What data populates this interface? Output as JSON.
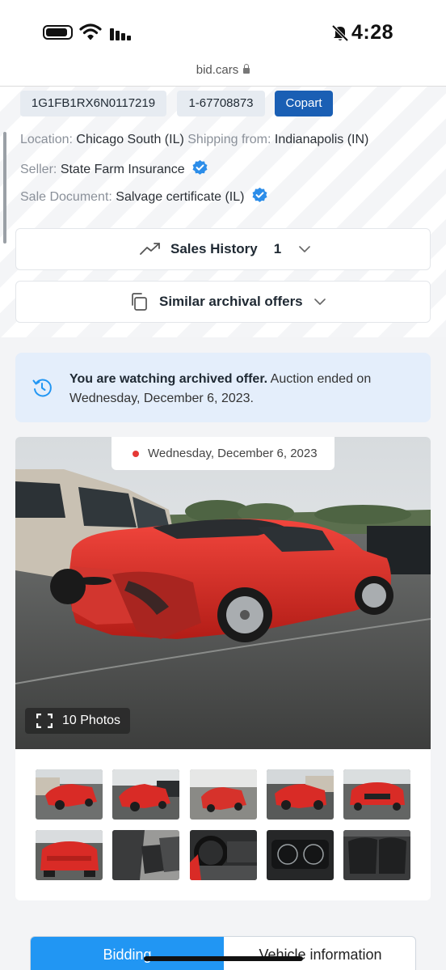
{
  "status_bar": {
    "time": "4:28",
    "battery_icon": "battery-icon",
    "wifi_icon": "wifi-icon",
    "signal_icon": "signal-icon",
    "bell_icon": "bell-muted-icon"
  },
  "browser": {
    "url": "bid.cars",
    "lock_icon": "lock-icon"
  },
  "identifiers": {
    "vin": "1G1FB1RX6N0117219",
    "lot": "1-67708873",
    "auction": "Copart"
  },
  "details": {
    "location_label": "Location:",
    "location_value": "Chicago South (IL)",
    "shipping_label": "Shipping from:",
    "shipping_value": "Indianapolis (IN)",
    "seller_label": "Seller:",
    "seller_value": "State Farm Insurance",
    "document_label": "Sale Document:",
    "document_value": "Salvage certificate (IL)"
  },
  "sales_history": {
    "label": "Sales History",
    "count": "1"
  },
  "similar_offers": {
    "label": "Similar archival offers"
  },
  "notice": {
    "bold": "You are watching archived offer.",
    "text": " Auction ended on Wednesday, December 6, 2023."
  },
  "gallery": {
    "date": "Wednesday, December 6, 2023",
    "photos_label": "10 Photos",
    "thumbnails": [
      "rear-left exterior",
      "rear-left exterior 2",
      "rear exterior",
      "front-left exterior",
      "front exterior",
      "rear exterior close",
      "front seats interior",
      "steering wheel interior",
      "instrument cluster",
      "rear seats interior"
    ]
  },
  "tabs": {
    "bidding": "Bidding",
    "vehicle_info": "Vehicle information"
  },
  "colors": {
    "primary_blue": "#2196f3",
    "copart_blue": "#1a5fb4",
    "car_red": "#d92b26",
    "notice_bg": "#e4eefb"
  }
}
